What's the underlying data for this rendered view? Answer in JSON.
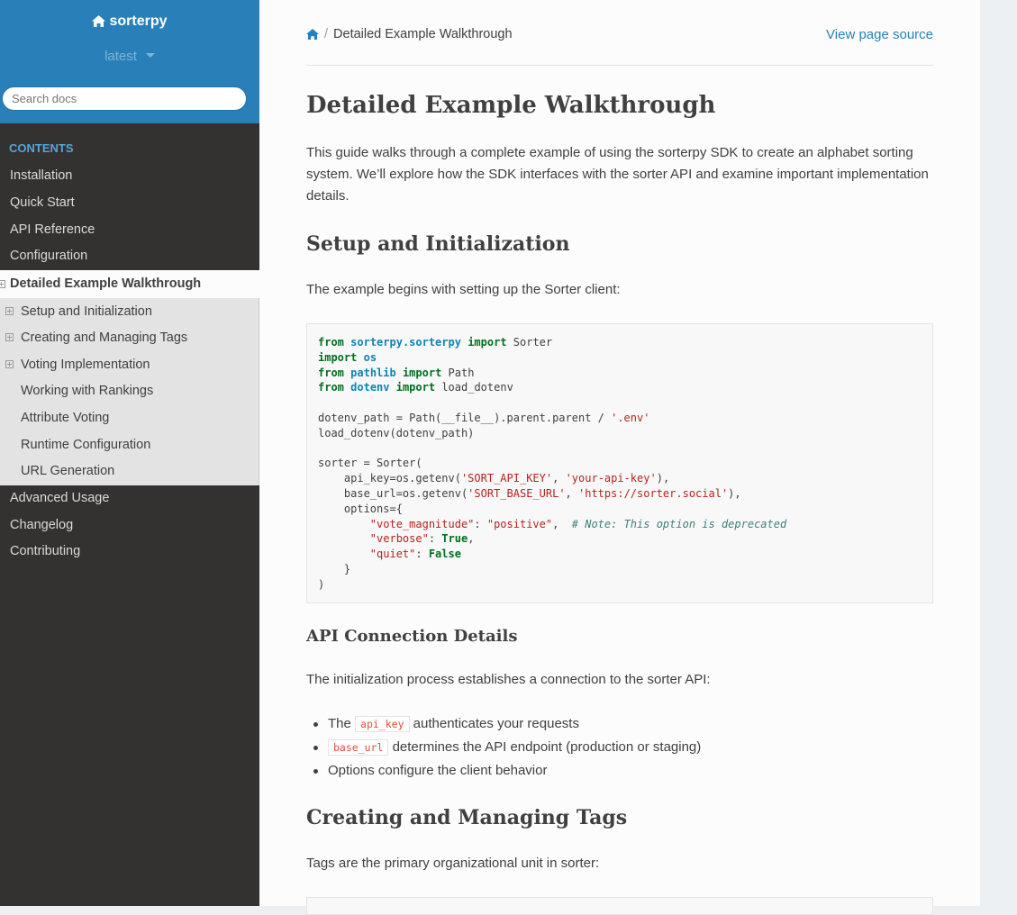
{
  "sidebar": {
    "project_name": "sorterpy",
    "version": "latest",
    "search_placeholder": "Search docs",
    "caption": "CONTENTS",
    "items_before": [
      "Installation",
      "Quick Start",
      "API Reference",
      "Configuration"
    ],
    "current": "Detailed Example Walkthrough",
    "sub_items": [
      {
        "label": "Setup and Initialization",
        "expandable": true
      },
      {
        "label": "Creating and Managing Tags",
        "expandable": true
      },
      {
        "label": "Voting Implementation",
        "expandable": true
      },
      {
        "label": "Working with Rankings",
        "expandable": false
      },
      {
        "label": "Attribute Voting",
        "expandable": false
      },
      {
        "label": "Runtime Configuration",
        "expandable": false
      },
      {
        "label": "URL Generation",
        "expandable": false
      }
    ],
    "items_after": [
      "Advanced Usage",
      "Changelog",
      "Contributing"
    ]
  },
  "breadcrumb": {
    "current": "Detailed Example Walkthrough",
    "view_source": "View page source"
  },
  "main": {
    "title": "Detailed Example Walkthrough",
    "intro": "This guide walks through a complete example of using the sorterpy SDK to create an alphabet sorting system. We’ll explore how the SDK interfaces with the sorter API and examine important implementation details.",
    "h_setup": "Setup and Initialization",
    "p_setup": "The example begins with setting up the Sorter client:",
    "code_lines": [
      "from sorterpy.sorterpy import Sorter",
      "import os",
      "from pathlib import Path",
      "from dotenv import load_dotenv",
      "",
      "dotenv_path = Path(__file__).parent.parent / '.env'",
      "load_dotenv(dotenv_path)",
      "",
      "sorter = Sorter(",
      "    api_key=os.getenv('SORT_API_KEY', 'your-api-key'),",
      "    base_url=os.getenv('SORT_BASE_URL', 'https://sorter.social'),",
      "    options={",
      "        \"vote_magnitude\": \"positive\",  # Note: This option is deprecated",
      "        \"verbose\": True,",
      "        \"quiet\": False",
      "    }",
      ")"
    ],
    "h_api": "API Connection Details",
    "p_api": "The initialization process establishes a connection to the sorter API:",
    "bullets": {
      "b1_pre": "The",
      "b1_code": "api_key",
      "b1_post": "authenticates your requests",
      "b2_code": "base_url",
      "b2_post": "determines the API endpoint (production or staging)",
      "b3": "Options configure the client behavior"
    },
    "h_tags": "Creating and Managing Tags",
    "p_tags": "Tags are the primary organizational unit in sorter:"
  },
  "colors": {
    "sidebar_top": "#2980b9",
    "sidebar_bg": "#343131",
    "link": "#2980b9",
    "caption": "#55a5d9"
  }
}
